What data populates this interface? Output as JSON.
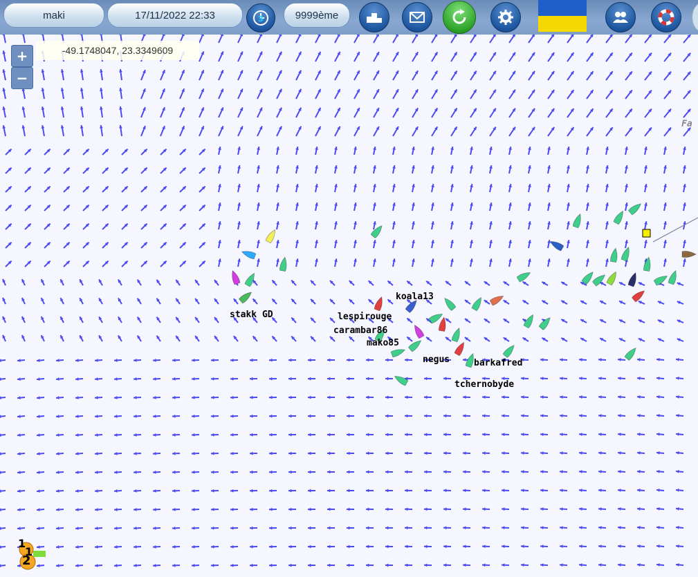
{
  "header": {
    "username": "maki",
    "datetime": "17/11/2022 22:33",
    "clock_badge": "3",
    "rank": "9999ème",
    "icons": [
      "podium-icon",
      "mail-icon",
      "refresh-icon",
      "gear-icon",
      "flag-ukraine",
      "users-icon",
      "lifebuoy-icon"
    ]
  },
  "map": {
    "coordinates": "-49.1748047, 23.3349609",
    "zoom_in_label": "+",
    "zoom_out_label": "−",
    "edge_label": "Fa",
    "boats": [
      "koala13",
      "lespirouge",
      "carambar86",
      "mako85",
      "negus",
      "barkafred",
      "tchernobyde",
      "stakk GD"
    ],
    "badge_numbers": [
      "1",
      "1",
      "2"
    ]
  },
  "colors": {
    "wind_arrow": "#4a4af0",
    "topbar": "#7d9cc8",
    "map_bg": "#f6f6ff"
  }
}
